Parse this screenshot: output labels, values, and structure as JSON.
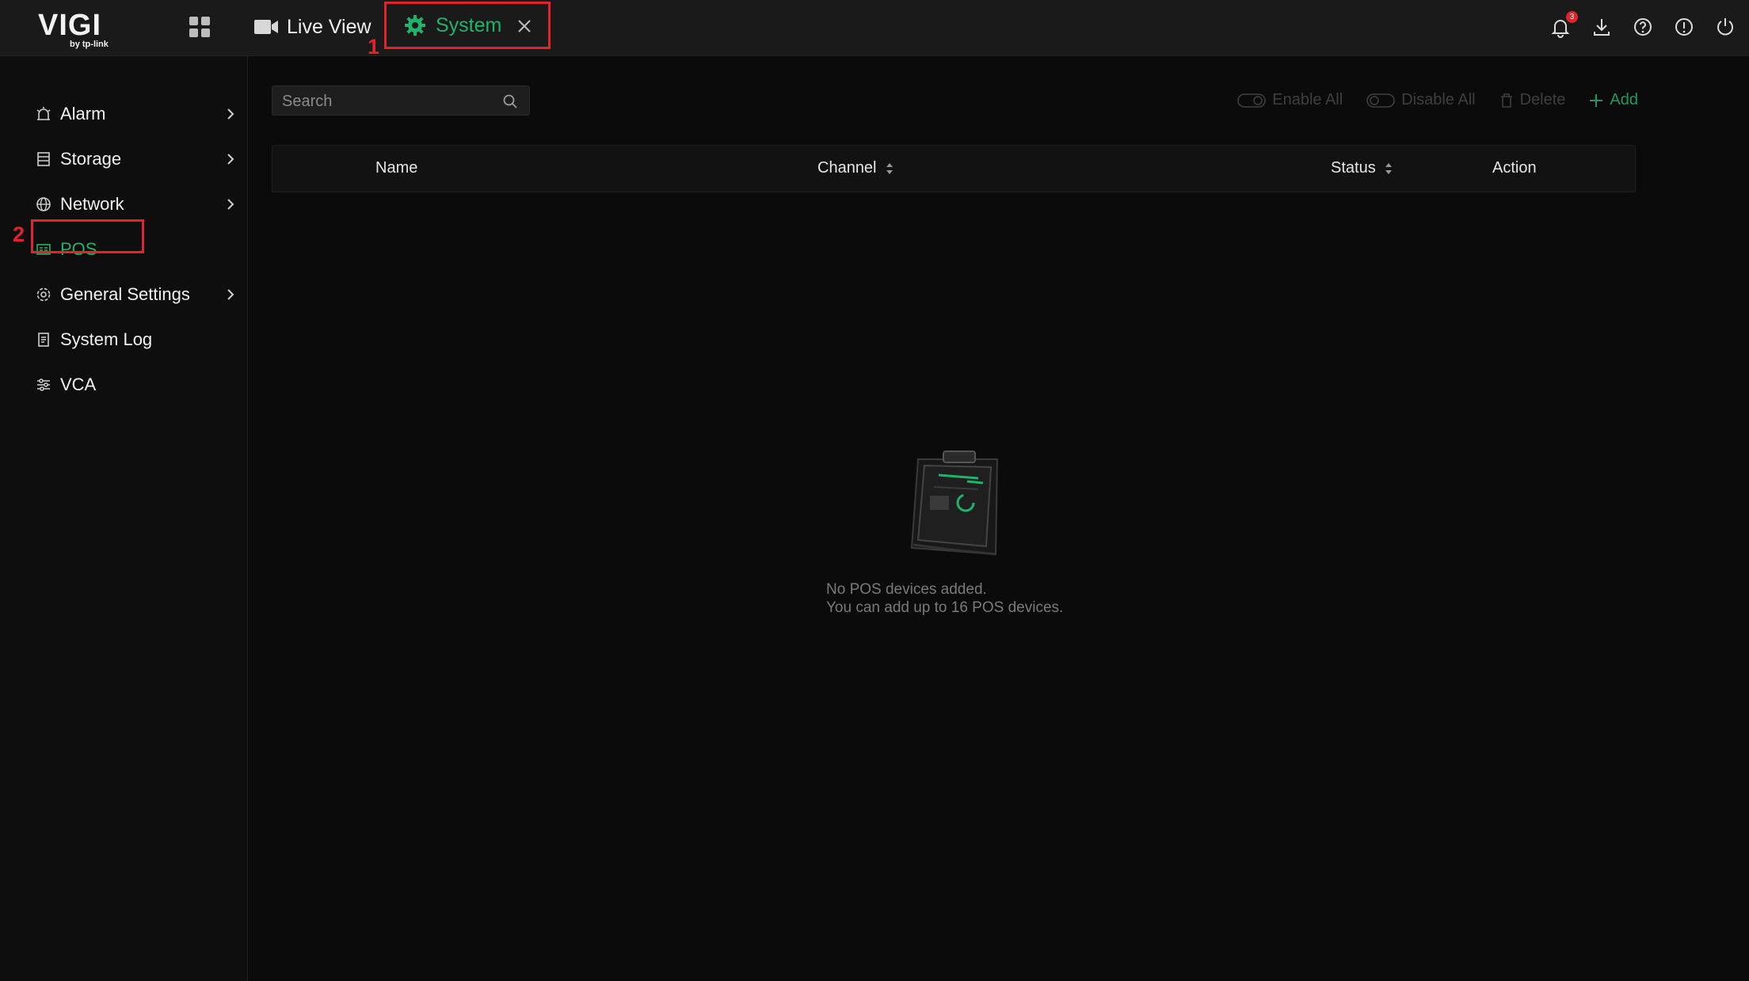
{
  "header": {
    "logo_text": "VIGI",
    "logo_sub": "by tp-link",
    "tabs": [
      {
        "label": "Live View",
        "icon": "video-camera-icon"
      },
      {
        "label": "System",
        "icon": "gear-icon",
        "active": true
      }
    ],
    "annotation_1": "1",
    "notification_count": "3"
  },
  "sidebar": {
    "items": [
      {
        "label": "Alarm",
        "icon": "alarm-icon",
        "has_chevron": true
      },
      {
        "label": "Storage",
        "icon": "storage-icon",
        "has_chevron": true
      },
      {
        "label": "Network",
        "icon": "globe-icon",
        "has_chevron": true
      },
      {
        "label": "POS",
        "icon": "pos-icon",
        "active": true
      },
      {
        "label": "General Settings",
        "icon": "settings-icon",
        "has_chevron": true
      },
      {
        "label": "System Log",
        "icon": "log-icon"
      },
      {
        "label": "VCA",
        "icon": "sliders-icon"
      }
    ],
    "annotation_2": "2"
  },
  "main": {
    "search_placeholder": "Search",
    "toolbar": {
      "enable_all": "Enable All",
      "disable_all": "Disable All",
      "delete": "Delete",
      "add": "Add"
    },
    "table": {
      "columns": [
        "Name",
        "Channel",
        "Status",
        "Action"
      ]
    },
    "empty": {
      "line1": "No POS devices added.",
      "line2": "You can add up to 16 POS devices."
    }
  },
  "colors": {
    "accent": "#21b36b",
    "annotation": "#e0242b",
    "background": "#0b0b0b"
  }
}
